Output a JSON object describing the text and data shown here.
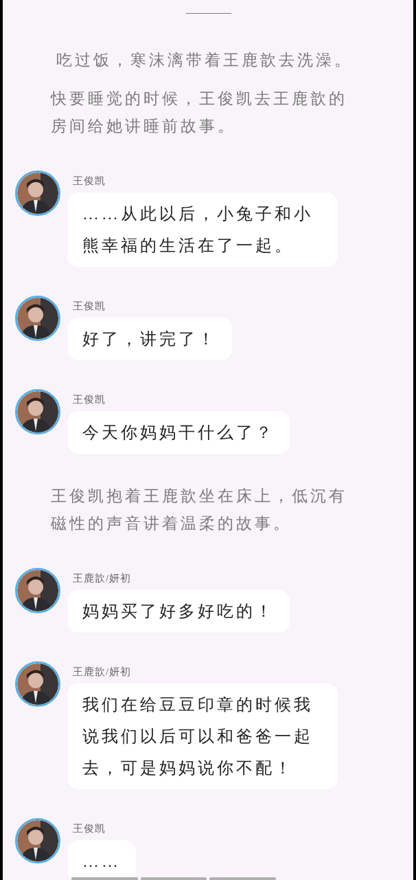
{
  "feed": [
    {
      "kind": "divider",
      "text": "————"
    },
    {
      "kind": "narration",
      "text": "吃过饭，寒沫漓带着王鹿歆去洗澡。",
      "indent": true
    },
    {
      "kind": "narration",
      "text": "快要睡觉的时候，王俊凯去王鹿歆的房间给她讲睡前故事。"
    },
    {
      "kind": "message",
      "sender": "王俊凯",
      "text": "……从此以后，小兔子和小熊幸福的生活在了一起。"
    },
    {
      "kind": "message",
      "sender": "王俊凯",
      "text": "好了，讲完了！"
    },
    {
      "kind": "message",
      "sender": "王俊凯",
      "text": "今天你妈妈干什么了？"
    },
    {
      "kind": "narration",
      "text": "王俊凯抱着王鹿歆坐在床上，低沉有磁性的声音讲着温柔的故事。"
    },
    {
      "kind": "message",
      "sender": "王鹿歆/妍初",
      "text": "妈妈买了好多好吃的！"
    },
    {
      "kind": "message",
      "sender": "王鹿歆/妍初",
      "text": "我们在给豆豆印章的时候我说我们以后可以和爸爸一起去，可是妈妈说你不配！"
    },
    {
      "kind": "message",
      "sender": "王俊凯",
      "text": "……"
    }
  ]
}
